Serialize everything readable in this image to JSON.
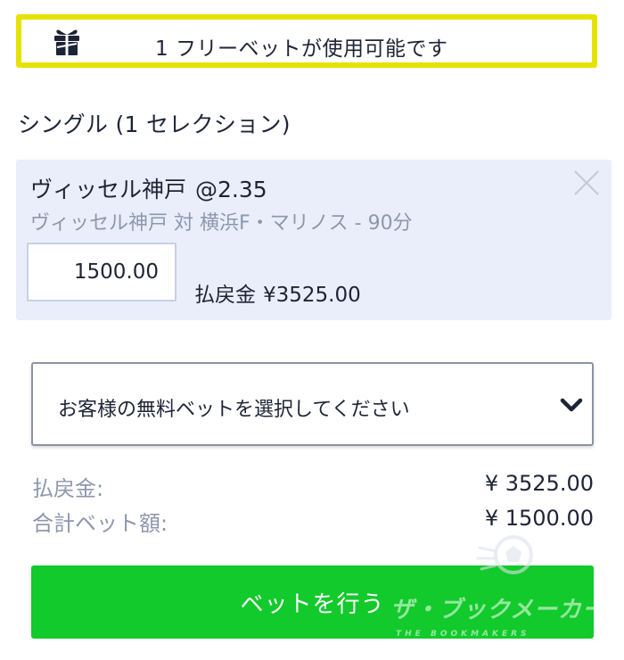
{
  "banner": {
    "text": "1 フリーベットが使用可能です",
    "icon": "gift-icon"
  },
  "section": {
    "title": "シングル (1 セレクション)"
  },
  "selection": {
    "team": "ヴィッセル神戸",
    "odds": "@2.35",
    "event": "ヴィッセル神戸 対 横浜F・マリノス - 90分",
    "stake": "1500.00",
    "payout_label": "払戻金",
    "payout_amount": "¥3525.00",
    "close_icon": "close-icon"
  },
  "free_bet_select": {
    "selected": "お客様の無料ベットを選択してください",
    "icon": "chevron-down-icon"
  },
  "summary": {
    "payout_label": "払戻金:",
    "payout_value": "¥ 3525.00",
    "total_label": "合計ベット額:",
    "total_value": "¥ 1500.00"
  },
  "place_bet": {
    "label": "ベットを行う"
  },
  "watermark": {
    "text": "ザ・ブックメーカーズ",
    "subtext": "THE BOOKMAKERS"
  },
  "colors": {
    "banner_border": "#e6e200",
    "card_bg": "#e9eefa",
    "muted_text": "#8d97ad",
    "primary_text": "#1d2436",
    "button_green": "#12ca2b"
  }
}
